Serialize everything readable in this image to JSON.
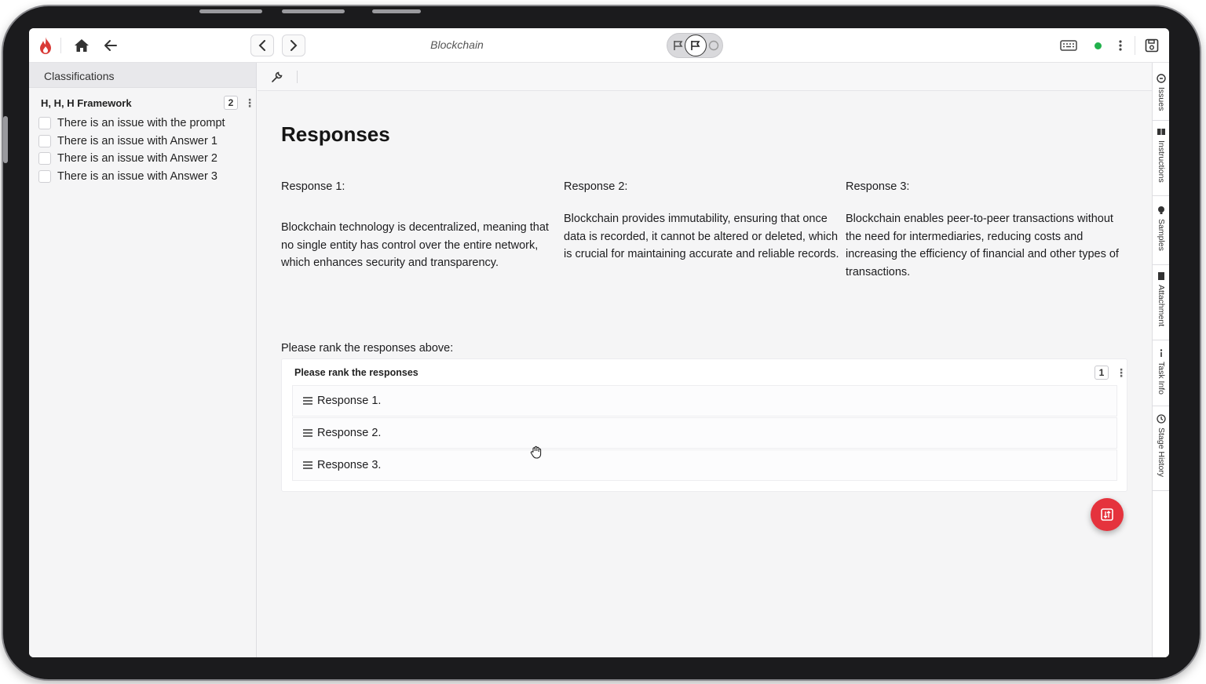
{
  "topbar": {
    "document_title": "Blockchain"
  },
  "classifications": {
    "header": "Classifications",
    "group_title": "H, H, H Framework",
    "group_count": "2",
    "items": [
      {
        "label": "There is an issue with the prompt",
        "checked": false
      },
      {
        "label": "There is an issue with Answer 1",
        "checked": false
      },
      {
        "label": "There is an issue with Answer 2",
        "checked": false
      },
      {
        "label": "There is an issue with Answer 3",
        "checked": false
      }
    ]
  },
  "main": {
    "title": "Responses",
    "responses": [
      {
        "heading": "Response 1:",
        "text": "Blockchain technology is decentralized, meaning that no single entity has control over the entire network, which enhances security and transparency."
      },
      {
        "heading": "Response 2:",
        "text": "Blockchain provides immutability, ensuring that once data is recorded, it cannot be altered or deleted, which is crucial for maintaining accurate and reliable records."
      },
      {
        "heading": "Response 3:",
        "text": "Blockchain enables peer-to-peer transactions without the need for intermediaries, reducing costs and increasing the efficiency of financial and other types of transactions."
      }
    ],
    "rank_prompt": "Please rank the responses above:",
    "rank_box": {
      "title": "Please rank the responses",
      "count": "1",
      "items": [
        "Response 1.",
        "Response 2.",
        "Response 3."
      ]
    }
  },
  "rail": {
    "tabs": [
      "Issues",
      "Instructions",
      "Samples",
      "Attachment",
      "Task Info",
      "Stage History"
    ]
  },
  "colors": {
    "accent_red": "#e5333d",
    "status_green": "#22b14c"
  },
  "icons": {
    "logo": "flame-logo-icon",
    "home": "home-icon",
    "back": "arrow-left-icon",
    "prev": "chevron-left-icon",
    "next": "chevron-right-icon",
    "keyboard": "keyboard-icon",
    "more": "more-vertical-icon",
    "save": "save-icon",
    "tool": "wrench-icon",
    "drag": "drag-handle-icon",
    "fab": "compare-icon",
    "cursor": "grab-hand-icon"
  }
}
